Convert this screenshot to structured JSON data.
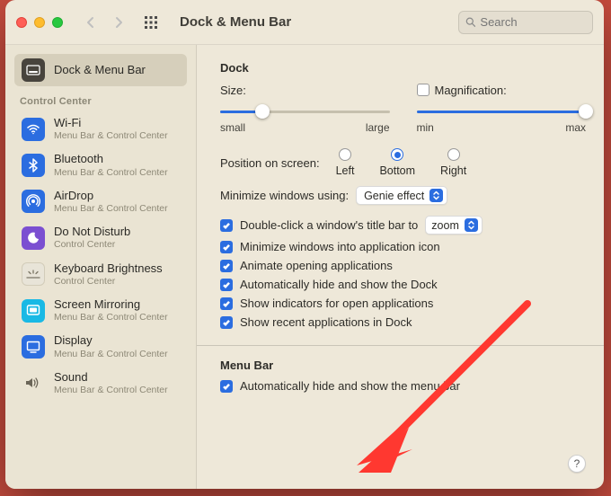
{
  "title": "Dock & Menu Bar",
  "search_placeholder": "Search",
  "sidebar": {
    "top": {
      "label": "Dock & Menu Bar"
    },
    "section": "Control Center",
    "items": [
      {
        "label": "Wi-Fi",
        "sub": "Menu Bar & Control Center"
      },
      {
        "label": "Bluetooth",
        "sub": "Menu Bar & Control Center"
      },
      {
        "label": "AirDrop",
        "sub": "Menu Bar & Control Center"
      },
      {
        "label": "Do Not Disturb",
        "sub": "Control Center"
      },
      {
        "label": "Keyboard Brightness",
        "sub": "Control Center"
      },
      {
        "label": "Screen Mirroring",
        "sub": "Menu Bar & Control Center"
      },
      {
        "label": "Display",
        "sub": "Menu Bar & Control Center"
      },
      {
        "label": "Sound",
        "sub": "Menu Bar & Control Center"
      }
    ]
  },
  "dock": {
    "heading": "Dock",
    "size_label": "Size:",
    "size_min": "small",
    "size_max": "large",
    "mag_label": "Magnification:",
    "mag_min": "min",
    "mag_max": "max",
    "position_label": "Position on screen:",
    "pos_left": "Left",
    "pos_bottom": "Bottom",
    "pos_right": "Right",
    "minimize_label": "Minimize windows using:",
    "minimize_value": "Genie effect",
    "dblclick_prefix": "Double-click a window's title bar to",
    "dblclick_value": "zoom",
    "c1": "Minimize windows into application icon",
    "c2": "Animate opening applications",
    "c3": "Automatically hide and show the Dock",
    "c4": "Show indicators for open applications",
    "c5": "Show recent applications in Dock"
  },
  "menubar": {
    "heading": "Menu Bar",
    "c1": "Automatically hide and show the menu bar"
  },
  "help": "?"
}
